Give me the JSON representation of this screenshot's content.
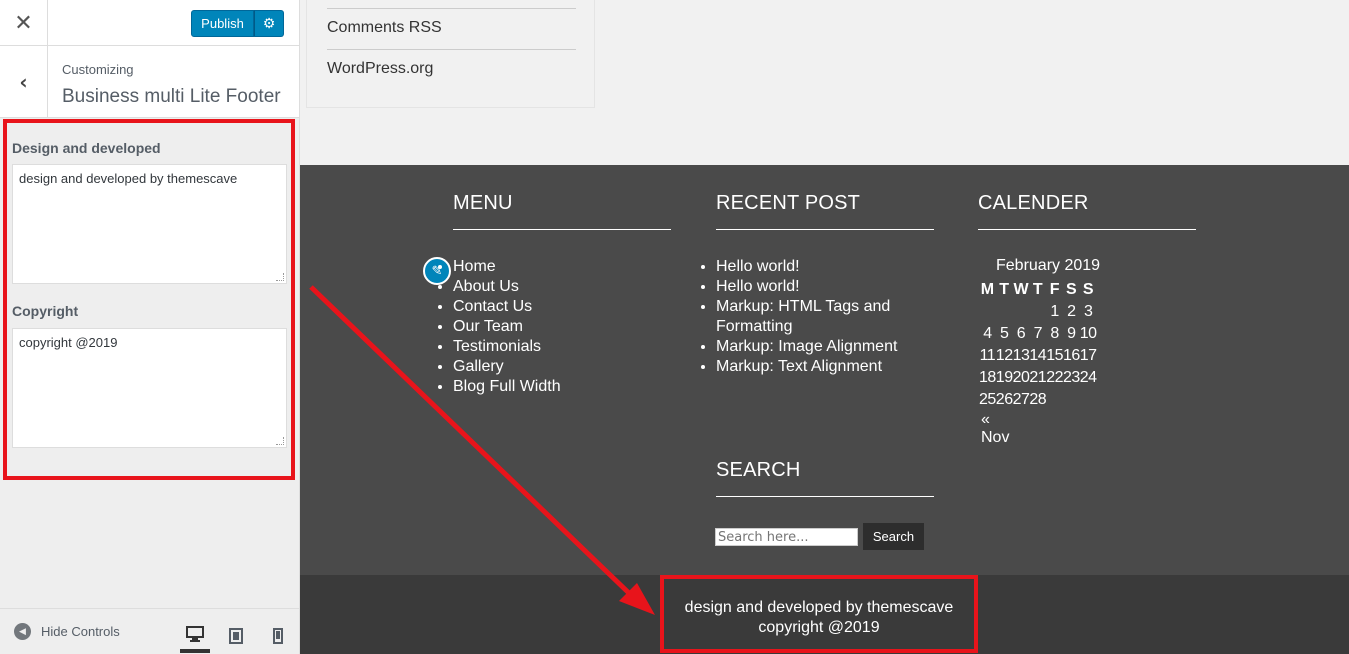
{
  "customizer": {
    "close_glyph": "✕",
    "publish_label": "Publish",
    "settings_glyph": "⚙",
    "back_glyph": "‹",
    "customizing_label": "Customizing",
    "section_title": "Business multi Lite Footer",
    "fields": [
      {
        "label": "Design and developed",
        "value": "design and developed by themescave"
      },
      {
        "label": "Copyright",
        "value": "copyright @2019"
      }
    ],
    "hide_controls_label": "Hide Controls",
    "hide_controls_glyph": "◀",
    "accent_color": "#0085ba"
  },
  "preview": {
    "meta_links": [
      "Comments RSS",
      "WordPress.org"
    ],
    "menu": {
      "title": "MENU",
      "items": [
        "Home",
        "About Us",
        "Contact Us",
        "Our Team",
        "Testimonials",
        "Gallery",
        "Blog Full Width"
      ]
    },
    "recent_post": {
      "title": "RECENT POST",
      "items": [
        "Hello world!",
        "Hello world!",
        "Markup: HTML Tags and Formatting",
        "Markup: Image Alignment",
        "Markup: Text Alignment"
      ]
    },
    "calendar": {
      "title": "CALENDER",
      "caption": "February 2019",
      "weekdays": [
        "M",
        "T",
        "W",
        "T",
        "F",
        "S",
        "S"
      ],
      "weeks": [
        [
          "",
          "",
          "",
          "",
          "1",
          "2",
          "3"
        ],
        [
          "4",
          "5",
          "6",
          "7",
          "8",
          "9",
          "10"
        ],
        [
          "11",
          "12",
          "13",
          "14",
          "15",
          "16",
          "17"
        ],
        [
          "18",
          "19",
          "20",
          "21",
          "22",
          "23",
          "24"
        ],
        [
          "25",
          "26",
          "27",
          "28",
          "",
          "",
          ""
        ]
      ],
      "prev_link": "« Nov"
    },
    "search": {
      "title": "SEARCH",
      "placeholder": "Search here...",
      "button_label": "Search"
    },
    "credit": {
      "line1": "design and developed by themescave",
      "line2": "copyright @2019"
    },
    "edit_glyph": "✎",
    "highlight_color": "#e8141b"
  }
}
